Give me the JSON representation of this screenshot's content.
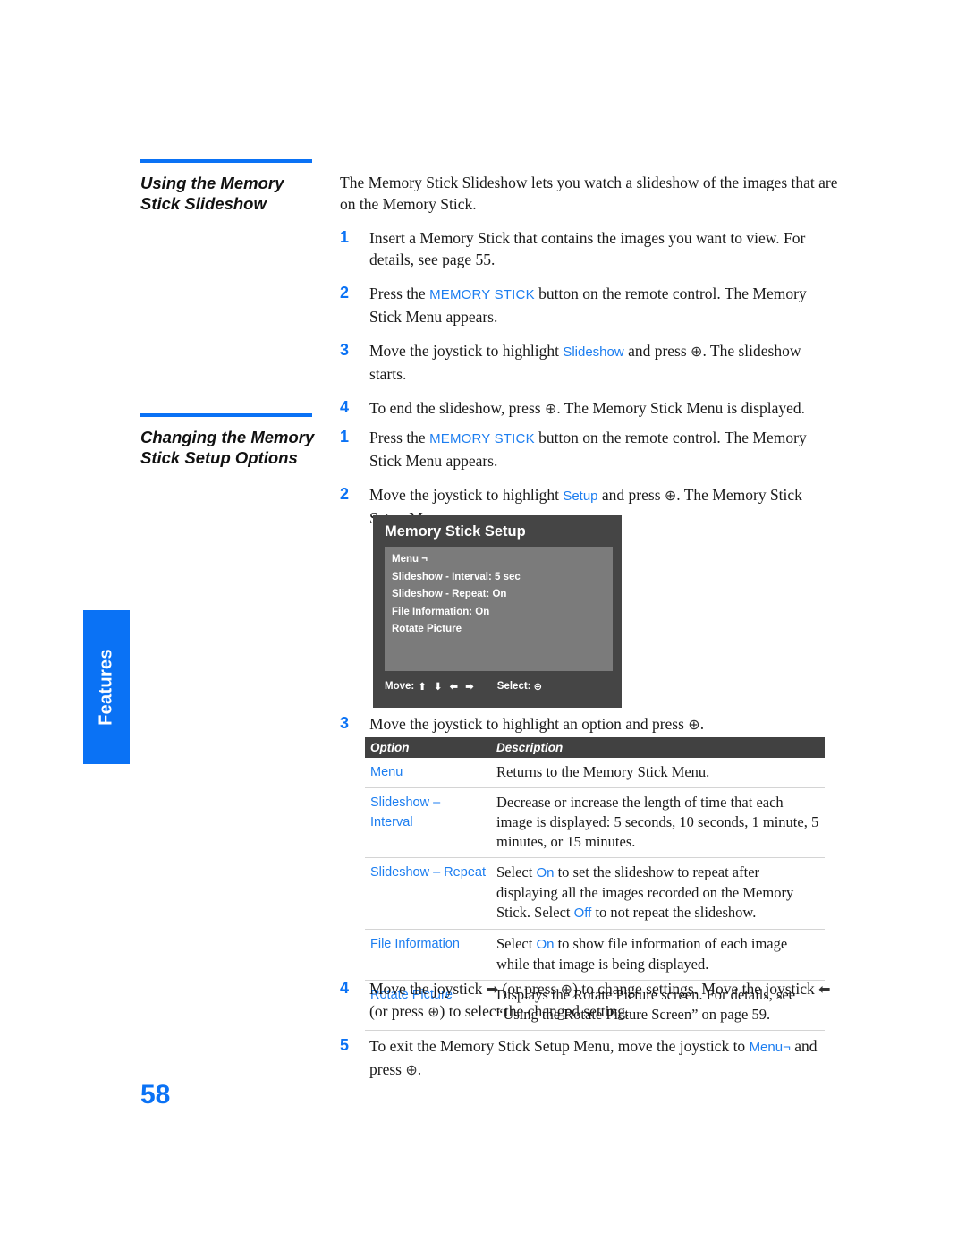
{
  "side_tab": {
    "label": "Features"
  },
  "page_number": "58",
  "sections": [
    {
      "heading": "Using the Memory Stick Slideshow",
      "intro": "The Memory Stick Slideshow lets you watch a slideshow of the images that are on the Memory Stick.",
      "steps": [
        {
          "num": "1",
          "text_1": "Insert a Memory Stick that contains the images you want to view. For details, see page 55."
        },
        {
          "num": "2",
          "text_1": "Press the ",
          "term": "MEMORY STICK",
          "text_2": " button on the remote control. The Memory Stick Menu appears."
        },
        {
          "num": "3",
          "text_1": "Move the joystick to highlight ",
          "term": "Slideshow",
          "text_2": " and press ",
          "glyph": "⊕",
          "text_3": ". The slideshow starts."
        },
        {
          "num": "4",
          "text_1": "To end the slideshow, press ",
          "glyph": "⊕",
          "text_2": ". The Memory Stick Menu is displayed."
        }
      ]
    },
    {
      "heading": "Changing the Memory Stick Setup Options",
      "steps": [
        {
          "num": "1",
          "text_1": "Press the ",
          "term": "MEMORY STICK",
          "text_2": " button on the remote control. The Memory Stick Menu appears."
        },
        {
          "num": "2",
          "text_1": "Move the joystick to highlight ",
          "term": "Setup",
          "text_2": " and press ",
          "glyph": "⊕",
          "text_3": ". The Memory Stick Setup Menu appears."
        },
        {
          "num": "3",
          "text_1": "Move the joystick to highlight an option and press ",
          "glyph": "⊕",
          "text_2": "."
        },
        {
          "num": "4",
          "text_1": "Move the joystick ",
          "glyph_a": "➡",
          "text_2": " (or press ",
          "glyph_b": "⊕",
          "text_3": ") to change settings. Move the joystick ",
          "glyph_c": "⬅",
          "text_4": " (or press ",
          "glyph_d": "⊕",
          "text_5": ") to select the changed setting."
        },
        {
          "num": "5",
          "text_1": "To exit the Memory Stick Setup Menu, move the joystick to ",
          "term": "Menu¬",
          "text_2": " and press ",
          "glyph": "⊕",
          "text_3": "."
        }
      ]
    }
  ],
  "tv_screen": {
    "title": "Memory Stick Setup",
    "items": [
      "Menu ¬",
      "Slideshow - Interval: 5 sec",
      "Slideshow - Repeat: On",
      "File Information: On",
      "Rotate Picture"
    ],
    "footer": {
      "move_label": "Move:",
      "arrows": "⬆ ⬇ ⬅ ➡",
      "select_label": "Select:",
      "select_glyph": "⊕"
    }
  },
  "options_table": {
    "headers": {
      "option": "Option",
      "description": "Description"
    },
    "rows": [
      {
        "option": "Menu",
        "desc_1": "Returns to the Memory Stick Menu.",
        "desc_2": "",
        "desc_3": "",
        "desc_4": ""
      },
      {
        "option": "Slideshow – Interval",
        "desc_1": "Decrease or increase the length of time that each image is displayed: 5 seconds, 10 seconds, 1 minute, 5 minutes, or 15 minutes.",
        "desc_2": "",
        "desc_3": "",
        "desc_4": ""
      },
      {
        "option": "Slideshow – Repeat",
        "desc_1": "Select ",
        "desc_hl_1": "On",
        "desc_2": " to set the slideshow to repeat after displaying all the images recorded on the Memory Stick. Select ",
        "desc_hl_2": "Off",
        "desc_3": " to not repeat the slideshow.",
        "desc_4": ""
      },
      {
        "option": "File Information",
        "desc_1": "Select ",
        "desc_hl_1": "On",
        "desc_2": " to show file information of each image while that image is being displayed.",
        "desc_3": "",
        "desc_4": ""
      },
      {
        "option": "Rotate Picture",
        "desc_1": "Displays the Rotate Picture screen. For details, see “Using the Rotate Picture Screen” on page 59.",
        "desc_2": "",
        "desc_3": "",
        "desc_4": ""
      }
    ]
  }
}
